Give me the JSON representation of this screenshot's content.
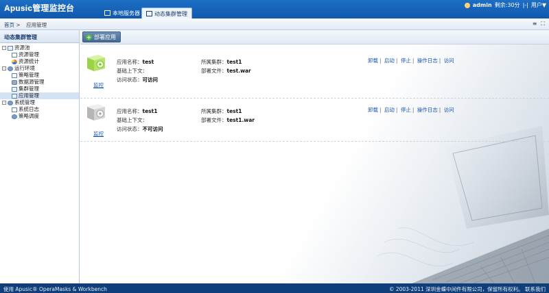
{
  "header": {
    "logo_brand": "Apusic",
    "logo_text": "管理监控台",
    "tabs": [
      {
        "label": "本地服务器",
        "icon": "monitor-icon"
      },
      {
        "label": "动态集群管理",
        "icon": "cluster-icon"
      }
    ],
    "username": "admin",
    "session": "剩余:30分",
    "separator": "|-|",
    "user_menu": "用户▼"
  },
  "breadcrumb": {
    "home": "首页",
    "sep": ">",
    "current": "应用管理"
  },
  "sidebar": {
    "title": "动态集群管理",
    "tree": [
      {
        "label": "资源池",
        "level": 1,
        "toggle": "-",
        "icon": "folder-icon"
      },
      {
        "label": "资源管理",
        "level": 2,
        "icon": "doc-icon"
      },
      {
        "label": "资源统计",
        "level": 2,
        "icon": "pie-chart-icon"
      },
      {
        "label": "运行环境",
        "level": 1,
        "toggle": "-",
        "icon": "gear-icon"
      },
      {
        "label": "策略管理",
        "level": 2,
        "icon": "doc-icon"
      },
      {
        "label": "数据源管理",
        "level": 2,
        "icon": "database-icon"
      },
      {
        "label": "集群管理",
        "level": 2,
        "icon": "cluster-icon"
      },
      {
        "label": "应用管理",
        "level": 2,
        "icon": "app-icon",
        "selected": true
      },
      {
        "label": "系统管理",
        "level": 1,
        "toggle": "-",
        "icon": "tools-icon"
      },
      {
        "label": "系统日志",
        "level": 2,
        "icon": "doc-icon"
      },
      {
        "label": "策略调度",
        "level": 2,
        "icon": "gear-icon"
      }
    ]
  },
  "toolbar": {
    "deploy_label": "部署应用"
  },
  "apps": [
    {
      "name_label": "应用名称：",
      "name": "test",
      "cluster_label": "所属集群：",
      "cluster": "test1",
      "context_label": "基础上下文：",
      "context": "",
      "file_label": "部署文件：",
      "file": "test.war",
      "status_label": "访问状态：",
      "status": "可访问",
      "monitor": "监控",
      "actions": [
        "卸载",
        "启动",
        "停止",
        "操作日志",
        "访问"
      ],
      "icon_color": "#8cd640"
    },
    {
      "name_label": "应用名称：",
      "name": "test1",
      "cluster_label": "所属集群：",
      "cluster": "test1",
      "context_label": "基础上下文：",
      "context": "",
      "file_label": "部署文件：",
      "file": "test1.war",
      "status_label": "访问状态：",
      "status": "不可访问",
      "monitor": "监控",
      "actions": [
        "卸载",
        "启动",
        "停止",
        "操作日志",
        "访问"
      ],
      "icon_color": "#c8c8c8"
    }
  ],
  "footer": {
    "left": "使用 Apusic® OperaMasks & Workbench",
    "right": "© 2003-2011 深圳金蝶中间件有限公司，保留所有权利。 联系我们"
  }
}
